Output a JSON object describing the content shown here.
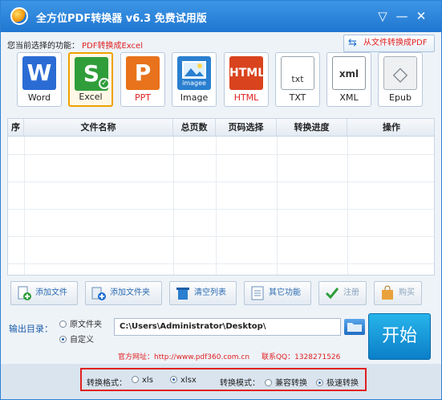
{
  "window": {
    "title": "全方位PDF转换器 v6.3 免费试用版",
    "controls": {
      "menu_icon": "dropdown-icon",
      "min_icon": "minimize-icon",
      "close_icon": "close-icon"
    }
  },
  "function": {
    "label": "您当前选择的功能：",
    "value": "PDF转换成Excel",
    "from_file_button": "从文件转换成PDF"
  },
  "formats": [
    {
      "label": "Word",
      "color": "#2b6cd4",
      "glyph": "W"
    },
    {
      "label": "Excel",
      "color": "#2f9e3a",
      "glyph": "S"
    },
    {
      "label": "PPT",
      "color": "#e8731c",
      "glyph": "P"
    },
    {
      "label": "Image",
      "color": "#2a7fd0",
      "glyph": "imagee"
    },
    {
      "label": "HTML",
      "color": "#d9431e",
      "glyph": "HTML"
    },
    {
      "label": "TXT",
      "color": "#9aa4ae",
      "glyph": "txt"
    },
    {
      "label": "XML",
      "color": "#8a949e",
      "glyph": "xml"
    },
    {
      "label": "Epub",
      "color": "#a9b0b6",
      "glyph": "◇"
    }
  ],
  "selected_format": "Excel",
  "table": {
    "headers": [
      "序",
      "文件名称",
      "总页数",
      "页码选择",
      "转换进度",
      "操作"
    ]
  },
  "toolbar": {
    "add_file": "添加文件",
    "add_folder": "添加文件夹",
    "clear_list": "清空列表",
    "other_functions": "其它功能",
    "register": "注册",
    "buy": "购买"
  },
  "output": {
    "label": "输出目录：",
    "option_original": "原文件夹",
    "option_custom": "自定义",
    "path": "C:\\Users\\Administrator\\Desktop\\",
    "start": "开始"
  },
  "site": {
    "text": "官方网址：http://www.pdf360.com.cn",
    "qq": "联系QQ：1328271526"
  },
  "settings": {
    "format_label": "转换格式：",
    "format_xls": "xls",
    "format_xlsx": "xlsx",
    "mode_label": "转换模式：",
    "mode_compat": "兼容转换",
    "mode_fast": "极速转换"
  },
  "colors": {
    "titlebar": "#2a80d6",
    "accent_red": "#e02020",
    "start_blue": "#0b7fc8"
  }
}
